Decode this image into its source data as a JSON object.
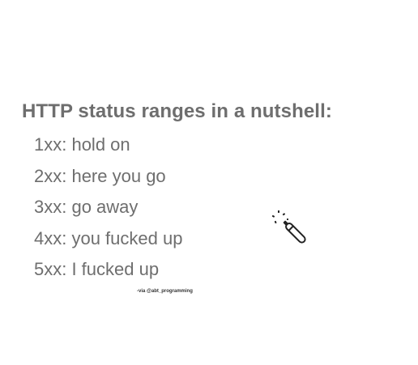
{
  "title": "HTTP status ranges in a nutshell:",
  "lines": [
    "1xx: hold on",
    "2xx: here you go",
    "3xx: go away",
    "4xx: you fucked up",
    "5xx: I fucked up"
  ],
  "credit": "-via @abt_programming",
  "icon": "magic-wand-icon"
}
